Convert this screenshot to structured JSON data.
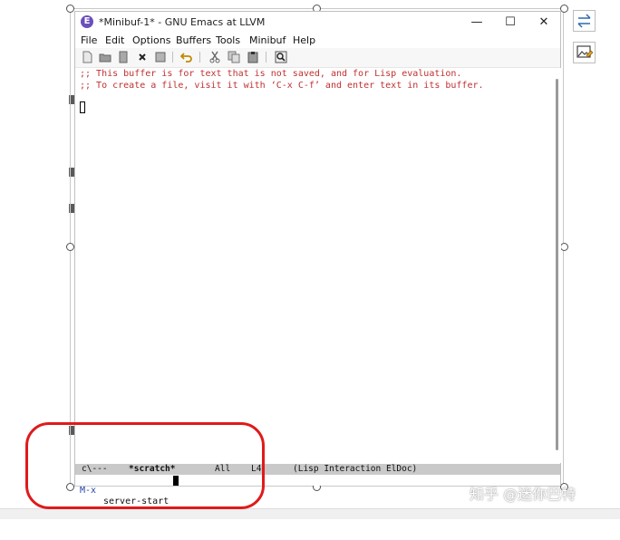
{
  "window": {
    "title": "*Minibuf-1* - GNU Emacs at LLVM",
    "app_icon": "E",
    "minimize": "—",
    "maximize": "☐",
    "close": "✕"
  },
  "menu": [
    "File",
    "Edit",
    "Options",
    "Buffers",
    "Tools",
    "Minibuf",
    "Help"
  ],
  "toolbar_icons": [
    "new-file-icon",
    "open-folder-icon",
    "save-icon",
    "close-x-icon",
    "disk-icon",
    "undo-icon",
    "cut-icon",
    "copy-icon",
    "paste-icon",
    "search-icon"
  ],
  "buffer": {
    "line1": ";; This buffer is for text that is not saved, and for Lisp evaluation.",
    "line2": ";; To create a file, visit it with ‘C-x C-f’ and enter text in its buffer."
  },
  "modeline": {
    "status": "c\\---",
    "buffer_name": "*scratch*",
    "position": "All",
    "line": "L4",
    "modes": "(Lisp Interaction ElDoc)"
  },
  "minibuffer": {
    "prompt": "M-x",
    "command": "server-start"
  },
  "watermark": "知乎 @迷你巴特",
  "colors": {
    "comment": "#c03030",
    "annotation": "#e01a1a",
    "modeline_bg": "#c9c9c9"
  }
}
